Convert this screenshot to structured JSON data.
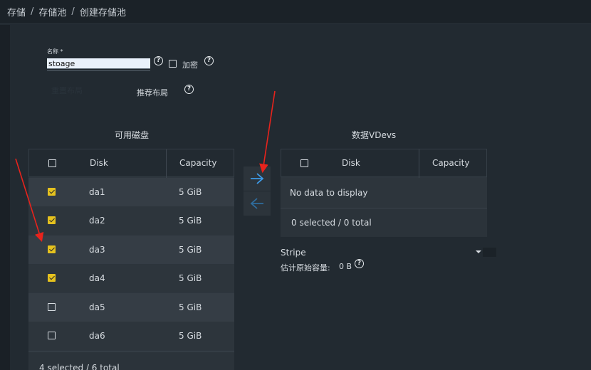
{
  "breadcrumb": {
    "items": [
      "存储",
      "存储池",
      "创建存储池"
    ],
    "sep": "/"
  },
  "form": {
    "name_label": "名称 *",
    "name_value": "stoage",
    "encrypt_label": "加密",
    "suggest_layout_label": "推荐布局",
    "ghost_button_label": "重置布局"
  },
  "available": {
    "title": "可用磁盘",
    "col_disk": "Disk",
    "col_capacity": "Capacity",
    "rows": [
      {
        "disk": "da1",
        "capacity": "5 GiB",
        "checked": true
      },
      {
        "disk": "da2",
        "capacity": "5 GiB",
        "checked": true
      },
      {
        "disk": "da3",
        "capacity": "5 GiB",
        "checked": true
      },
      {
        "disk": "da4",
        "capacity": "5 GiB",
        "checked": true
      },
      {
        "disk": "da5",
        "capacity": "5 GiB",
        "checked": false
      },
      {
        "disk": "da6",
        "capacity": "5 GiB",
        "checked": false
      }
    ],
    "footer": "4 selected / 6 total"
  },
  "vdevs": {
    "title": "数据VDevs",
    "col_disk": "Disk",
    "col_capacity": "Capacity",
    "empty": "No data to display",
    "footer": "0 selected / 0 total",
    "layout_value": "Stripe",
    "estimate_label": "估计原始容量:",
    "estimate_value": "0 B"
  },
  "icons": {
    "move_right": "arrow-right-icon",
    "move_left": "arrow-left-icon",
    "help": "help-circle-icon"
  },
  "colors": {
    "accent_check": "#e6c21e",
    "arrow_blue": "#3d9be9",
    "annotation_red": "#e8231c"
  }
}
